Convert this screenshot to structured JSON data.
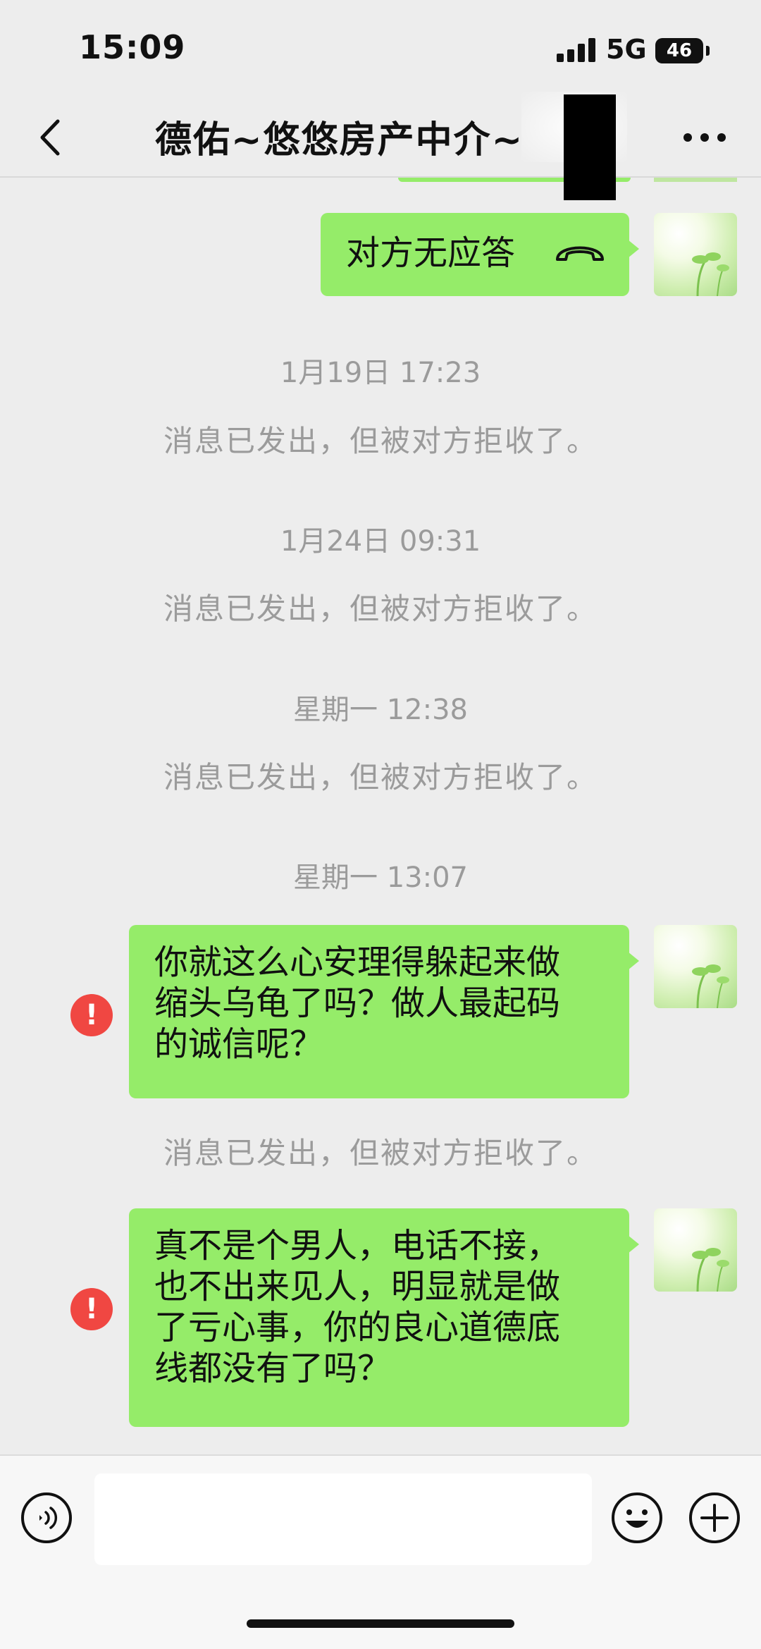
{
  "status_bar": {
    "time": "15:09",
    "network": "5G",
    "battery": "46"
  },
  "nav": {
    "title": "德佑~悠悠房产中介~"
  },
  "messages": {
    "call_status": "对方无应答",
    "ts1": "1月19日 17:23",
    "sys1": "消息已发出，但被对方拒收了。",
    "ts2": "1月24日 09:31",
    "sys2": "消息已发出，但被对方拒收了。",
    "ts3": "星期一 12:38",
    "sys3": "消息已发出，但被对方拒收了。",
    "ts4": "星期一 13:07",
    "msg1": "你就这么心安理得躲起来做\n缩头乌龟了吗？做人最起码\n的诚信呢？",
    "sys4": "消息已发出，但被对方拒收了。",
    "msg2": "真不是个男人，电话不接，\n也不出来见人，明显就是做\n了亏心事，你的良心道德底\n线都没有了吗？",
    "error_mark": "!"
  },
  "colors": {
    "bubble": "#95ec69",
    "background": "#ededed",
    "error": "#f04742",
    "system_text": "#9b9b9b"
  },
  "icons": [
    "back-icon",
    "more-icon",
    "hangup-icon",
    "error-icon",
    "voice-icon",
    "emoji-icon",
    "plus-icon"
  ]
}
